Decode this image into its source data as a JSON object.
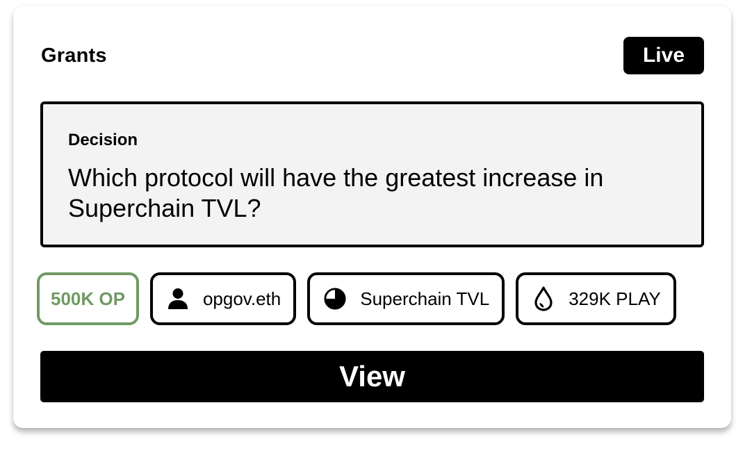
{
  "card": {
    "category": "Grants",
    "status": "Live",
    "decision": {
      "label": "Decision",
      "question": "Which protocol will have the greatest increase in Superchain TVL?"
    },
    "tags": {
      "grant": {
        "label": "500K OP",
        "color": "#6f9a63"
      },
      "proposer": {
        "label": "opgov.eth",
        "icon": "user-icon"
      },
      "metric": {
        "label": "Superchain TVL",
        "icon": "pie-chart-icon"
      },
      "liquidity": {
        "label": "329K PLAY",
        "icon": "droplet-icon"
      }
    },
    "action": {
      "label": "View"
    }
  }
}
